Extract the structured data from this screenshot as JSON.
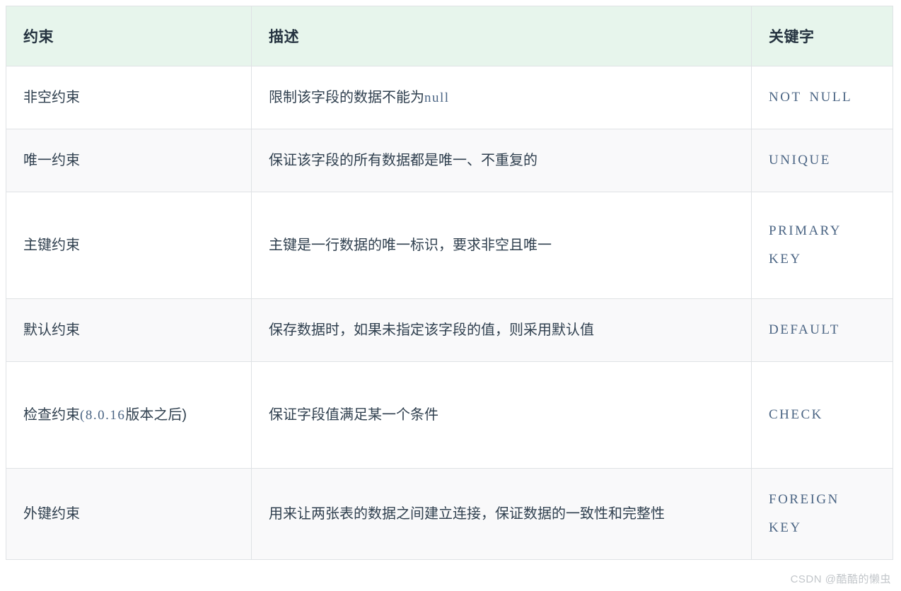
{
  "theme": {
    "header_bg": "#e7f5ec",
    "border": "#dfe2e5",
    "row_alt_bg": "#f9f9fa",
    "text": "#30404f",
    "keyword_text": "#4b6584",
    "watermark_text": "#c2c6ca"
  },
  "table": {
    "headers": [
      "约束",
      "描述",
      "关键字"
    ],
    "rows": [
      {
        "name": "非空约束",
        "name_mono": "",
        "name_tail": "",
        "desc_pre": "限制该字段的数据不能为",
        "desc_mono": "null",
        "desc_post": "",
        "keyword": "NOT NULL"
      },
      {
        "name": "唯一约束",
        "name_mono": "",
        "name_tail": "",
        "desc_pre": "保证该字段的所有数据都是唯一、不重复的",
        "desc_mono": "",
        "desc_post": "",
        "keyword": "UNIQUE"
      },
      {
        "name": "主键约束",
        "name_mono": "",
        "name_tail": "",
        "desc_pre": "主键是一行数据的唯一标识，要求非空且唯一",
        "desc_mono": "",
        "desc_post": "",
        "keyword": "PRIMARY KEY"
      },
      {
        "name": "默认约束",
        "name_mono": "",
        "name_tail": "",
        "desc_pre": "保存数据时，如果未指定该字段的值，则采用默认值",
        "desc_mono": "",
        "desc_post": "",
        "keyword": "DEFAULT"
      },
      {
        "name": "检查约束",
        "name_mono": "(8.0.16",
        "name_tail": "版本之后)",
        "desc_pre": "保证字段值满足某一个条件",
        "desc_mono": "",
        "desc_post": "",
        "keyword": "CHECK"
      },
      {
        "name": "外键约束",
        "name_mono": "",
        "name_tail": "",
        "desc_pre": "用来让两张表的数据之间建立连接，保证数据的一致性和完整性",
        "desc_mono": "",
        "desc_post": "",
        "keyword": "FOREIGN KEY"
      }
    ]
  },
  "watermark": {
    "text": "CSDN @酷酷的懒虫"
  }
}
